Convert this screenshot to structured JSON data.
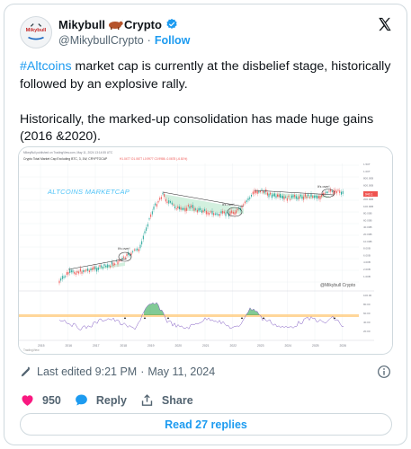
{
  "author": {
    "name": "Mikybull",
    "name_suffix": "Crypto",
    "handle": "@MikybullCrypto",
    "separator": "·",
    "follow_label": "Follow",
    "avatar_text": "Mikybull",
    "verified_color": "#1d9bf0"
  },
  "tweet": {
    "hashtag": "#Altcoins",
    "line1_rest": " market cap is currently at the disbelief stage, historically followed by an explosive rally.",
    "line2": "Historically, the marked-up consolidation has made huge gains (2016 &2020)."
  },
  "chart": {
    "header_line1": "MikeyBull published on TradingView.com, May 11, 2024 13:14:55 UTC",
    "header_line2": "Crypto Total Market Cap Excluding BTC, 3, 1W, CRYPTOCAP",
    "ohlc": "H1.0477  O1.0677  L0.9977  C0.9986  -0.0678 (-6.81%)",
    "series_label": "ALTCOINS MARKETCAP",
    "watermark": "@Mikybull Crypto",
    "annotations": [
      "It's over!",
      "It's over!",
      "It's over!"
    ],
    "price_axis": [
      "1.50T",
      "1.00T",
      "800.00B",
      "600.00B",
      "400.00B",
      "200.00B",
      "100.00B",
      "80.00B",
      "60.00B",
      "40.00B",
      "20.00B",
      "10.00B",
      "8.00B",
      "6.00B",
      "4.00B",
      "2.00B",
      "1.00B"
    ],
    "price_tag": "940.1",
    "osc_axis": [
      "100.00",
      "80.00",
      "60.00",
      "40.00",
      "20.00"
    ],
    "years": [
      "2015",
      "2016",
      "2017",
      "2018",
      "2019",
      "2020",
      "2021",
      "2022",
      "2023",
      "2024",
      "2025",
      "2026"
    ],
    "tv_logo": "TradingView",
    "accent": "#1a9e3f",
    "candle_up": "#26a69a",
    "candle_down": "#ef5350",
    "label_color": "#4fc3f7"
  },
  "footer": {
    "edited_prefix": "Last edited",
    "time": "9:21 PM",
    "separator": "·",
    "date": "May 11, 2024",
    "likes_count": "950",
    "reply_label": "Reply",
    "share_label": "Share",
    "read_replies_label": "Read 27 replies"
  }
}
